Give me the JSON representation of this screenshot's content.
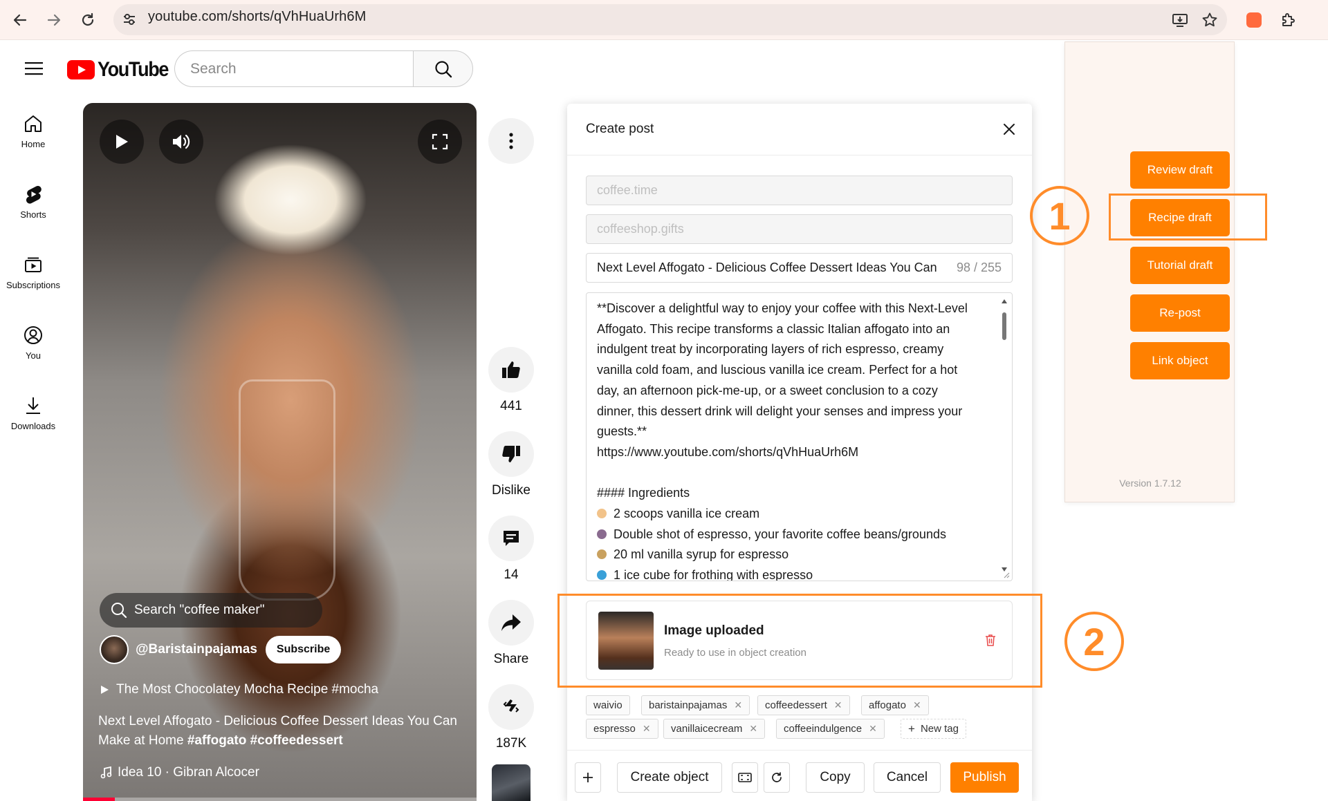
{
  "browser": {
    "url": "youtube.com/shorts/qVhHuaUrh6M"
  },
  "youtube": {
    "logo_text": "YouTube",
    "search_placeholder": "Search",
    "sidebar": [
      {
        "label": "Home",
        "icon": "home-icon"
      },
      {
        "label": "Shorts",
        "icon": "shorts-icon"
      },
      {
        "label": "Subscriptions",
        "icon": "subscriptions-icon"
      },
      {
        "label": "You",
        "icon": "account-icon"
      },
      {
        "label": "Downloads",
        "icon": "download-icon"
      }
    ]
  },
  "video": {
    "search_suggestion": "Search \"coffee maker\"",
    "channel": "@Baristainpajamas",
    "subscribe_label": "Subscribe",
    "playlist_line": "The Most Chocolatey Mocha Recipe #mocha",
    "title_plain": "Next Level Affogato - Delicious Coffee Dessert Ideas You Can Make at Home ",
    "title_hashtags": "#affogato #coffeedessert",
    "music_line": "Idea 10 · Gibran Alcocer",
    "progress_fraction": 0.08
  },
  "actions": {
    "likes": "441",
    "dislike_label": "Dislike",
    "comments": "14",
    "share_label": "Share",
    "remix_count": "187K"
  },
  "create_post": {
    "title": "Create post",
    "field_account": "coffee.time",
    "field_community": "coffeeshop.gifts",
    "post_title": "Next Level Affogato - Delicious Coffee Dessert Ideas You Can",
    "title_counter": "98 / 255",
    "body_lines": [
      "**Discover a delightful way to enjoy your coffee with this Next-Level",
      "Affogato. This recipe transforms a classic Italian affogato into an",
      "indulgent treat by incorporating layers of rich espresso, creamy",
      "vanilla cold foam, and luscious vanilla ice cream. Perfect for a hot",
      "day, an afternoon pick-me-up, or a sweet conclusion to a cozy",
      "dinner, this dessert drink will delight your senses and impress your",
      "guests.**",
      "https://www.youtube.com/shorts/qVhHuaUrh6M"
    ],
    "ingredients_heading": "#### Ingredients",
    "ingredients": [
      {
        "text": "2 scoops vanilla ice cream",
        "color": "#f2c38a"
      },
      {
        "text": "Double shot of espresso, your favorite coffee beans/grounds",
        "color": "#8a6b8f"
      },
      {
        "text": "20 ml vanilla syrup for espresso",
        "color": "#c9a15f"
      },
      {
        "text": "1 ice cube for frothing with espresso",
        "color": "#3aa0d8"
      }
    ],
    "upload": {
      "title": "Image uploaded",
      "subtitle": "Ready to use in object creation"
    },
    "tags": [
      "waivio",
      "baristainpajamas",
      "coffeedessert",
      "affogato",
      "espresso",
      "vanillaicecream",
      "coffeeindulgence"
    ],
    "new_tag_label": "New tag",
    "buttons": {
      "create_object": "Create object",
      "copy": "Copy",
      "cancel": "Cancel",
      "publish": "Publish"
    }
  },
  "extension": {
    "buttons": [
      "Review draft",
      "Recipe draft",
      "Tutorial draft",
      "Re-post",
      "Link object"
    ],
    "version": "Version 1.7.12",
    "accent_color": "#ff8000"
  },
  "annotations": {
    "marker_1": "1",
    "marker_2": "2",
    "color": "#ff8c2a"
  }
}
